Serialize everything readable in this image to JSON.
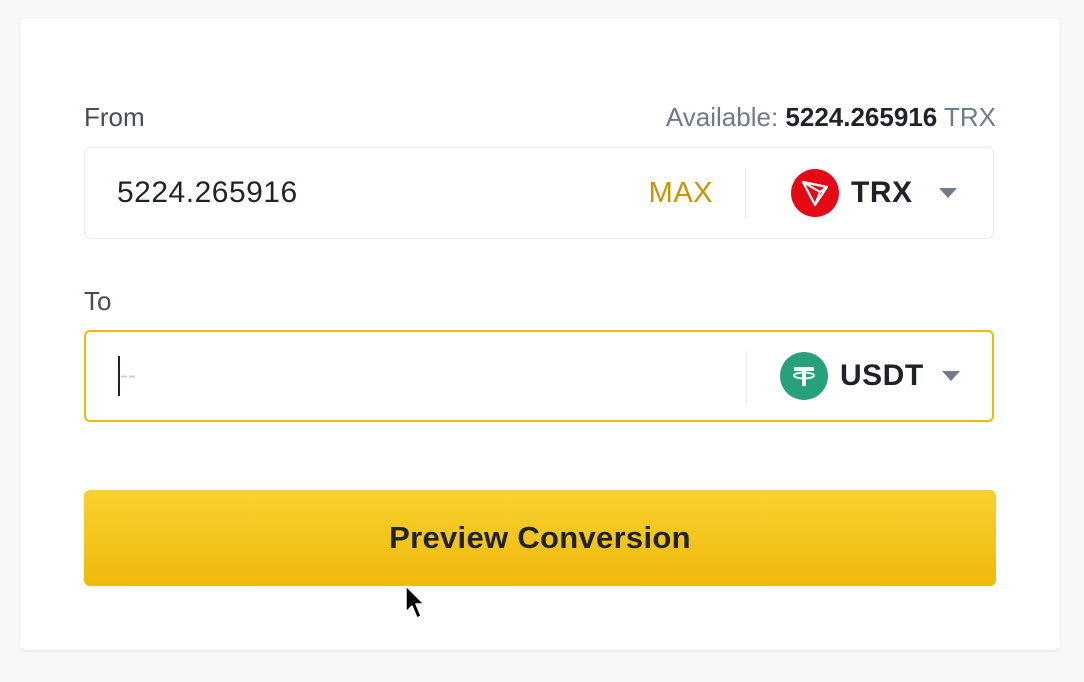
{
  "from": {
    "label": "From",
    "available_prefix": "Available: ",
    "available_amount": "5224.265916",
    "available_unit": " TRX",
    "value": "5224.265916",
    "max_label": "MAX",
    "coin": "TRX",
    "coin_icon": "tron-icon",
    "coin_color": "#e50915"
  },
  "to": {
    "label": "To",
    "placeholder": "--",
    "coin": "USDT",
    "coin_icon": "tether-icon",
    "coin_color": "#26a17b"
  },
  "actions": {
    "preview_label": "Preview Conversion"
  },
  "colors": {
    "accent": "#f0b90b",
    "max_text": "#c99400"
  }
}
